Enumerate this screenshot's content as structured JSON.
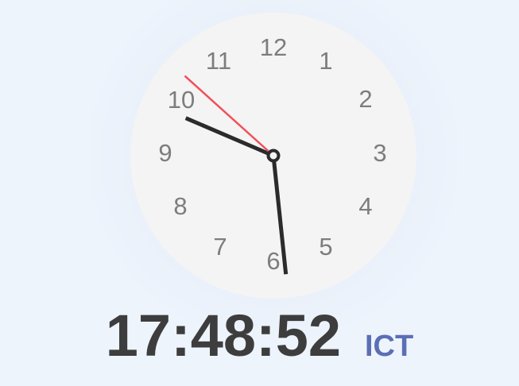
{
  "clock": {
    "numerals": [
      "12",
      "1",
      "2",
      "3",
      "4",
      "5",
      "6",
      "7",
      "8",
      "9",
      "10",
      "11"
    ],
    "time": {
      "hours": 17,
      "minutes": 48,
      "seconds": 52
    },
    "colors": {
      "face": "#f4f4f4",
      "numerals": "#7d7d7d",
      "hour_hand": "#2b2b2d",
      "minute_hand": "#2b2b2d",
      "second_hand": "#f0505a",
      "center": "#2b2b2d"
    }
  },
  "digital": {
    "time_text": "17:48:52",
    "timezone": "ICT",
    "colors": {
      "time": "#3d3d3d",
      "timezone": "#5a6fb5"
    }
  }
}
